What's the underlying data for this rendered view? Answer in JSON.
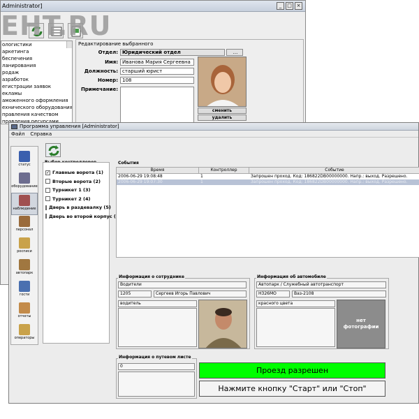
{
  "back_window": {
    "title": "Administrator]",
    "watermark": "EHT.RU",
    "list_items": [
      "ологистики",
      "аркетинга",
      "беспечения",
      "ланирования",
      "родаж",
      "азработок",
      "егистрации заявок",
      "екламы",
      "аможенного оформления",
      "ехнического оборудования",
      "правления качеством",
      "правления ресурсами"
    ],
    "edit_group": {
      "title": "Редактирование выбранного",
      "department_label": "Отдел:",
      "department_value": "Юридический отдел",
      "browse_label": "...",
      "name_label": "Имя:",
      "name_value": "Иванова Мария Сергеевна",
      "position_label": "Должность:",
      "position_value": "старший юрист",
      "number_label": "Номер:",
      "number_value": "108",
      "note_label": "Примечание:",
      "change_btn": "сменить",
      "delete_btn": "удалить"
    }
  },
  "front_window": {
    "title": "Программа управления [Administrator]",
    "menu": [
      "Файл",
      "Справка"
    ],
    "sidebar": [
      {
        "label": "статус",
        "icon": "person-icon",
        "color": "#3a5fae"
      },
      {
        "label": "оборудование",
        "icon": "equipment-icon",
        "color": "#6d6d8f"
      },
      {
        "label": "наблюдение",
        "icon": "monitor-icon",
        "color": "#a05050"
      },
      {
        "label": "персонал",
        "icon": "staff-icon",
        "color": "#9a6b3c"
      },
      {
        "label": "росписи",
        "icon": "folder-icon",
        "color": "#c9a24a"
      },
      {
        "label": "автопарк",
        "icon": "car-icon",
        "color": "#a07740"
      },
      {
        "label": "гости",
        "icon": "guests-icon",
        "color": "#4a70b0"
      },
      {
        "label": "отчеты",
        "icon": "report-icon",
        "color": "#c38b4a"
      },
      {
        "label": "операторы",
        "icon": "operators-icon",
        "color": "#c9a24a"
      }
    ],
    "controllers_title": "Выбор контроллеров",
    "controllers": [
      {
        "label": "Главные ворота (1)",
        "checked": true
      },
      {
        "label": "Вторые ворота (2)",
        "checked": false
      },
      {
        "label": "Турникет 1 (3)",
        "checked": false
      },
      {
        "label": "Турникет 2 (4)",
        "checked": false
      },
      {
        "label": "Дверь в раздевалку (5)",
        "checked": false
      },
      {
        "label": "Дверь во второй корпус (6",
        "checked": false
      }
    ],
    "events_title": "События",
    "events_columns": [
      "Время",
      "Контроллер",
      "Событие"
    ],
    "events_rows": [
      {
        "time": "2006-06-29 19:08:48",
        "controller": "1",
        "event": "Запрошен проход. Код: 186822DB00000000. Напр.: выход. Разрешено.",
        "selected": false
      },
      {
        "time": "2006-06-29 19:07:30",
        "controller": "1",
        "event": "Запрошен проход. Код: 186822DB00000000. Напр.: выход. Разрешено.",
        "selected": true
      }
    ],
    "employee": {
      "title": "Информация о сотруднике",
      "department": "Водители",
      "number": "1205",
      "name": "Сергеев Игорь Павлович",
      "position": "водитель"
    },
    "vehicle": {
      "title": "Информация об автомобиле",
      "group": "Автопарк / Служебный автотранспорт",
      "plate": "Н326МО",
      "model": "Ваз-2108",
      "color": "красного цвета",
      "no_photo_line1": "нет",
      "no_photo_line2": "фотографии"
    },
    "waybill": {
      "title": "Информация о путевом листе",
      "value": "0"
    },
    "status_ok": "Проезд разрешен",
    "status_ok_color": "#00ff00",
    "status_message": "Нажмите кнопку \"Старт\" или \"Стоп\""
  }
}
